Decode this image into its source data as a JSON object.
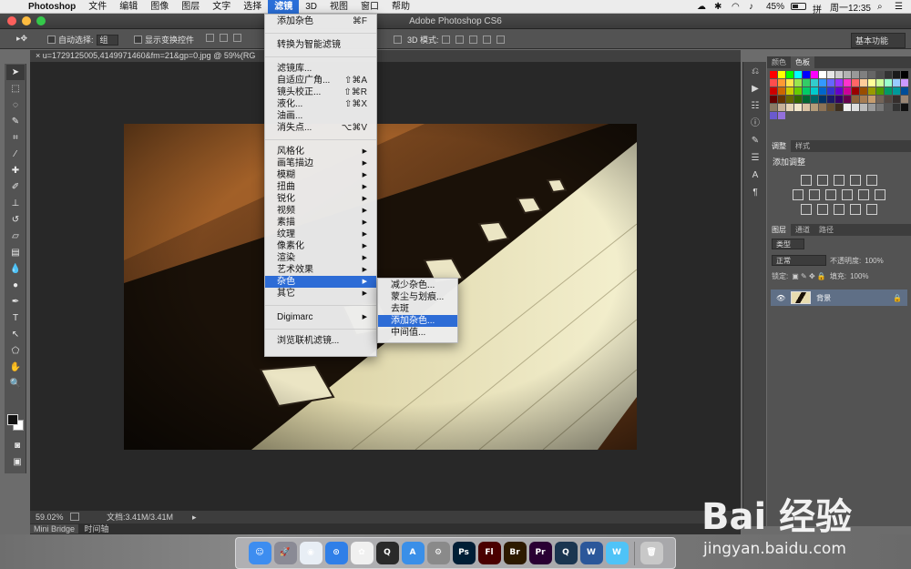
{
  "menubar": {
    "app_name": "Photoshop",
    "items": [
      "文件",
      "编辑",
      "图像",
      "图层",
      "文字",
      "选择",
      "滤镜",
      "3D",
      "视图",
      "窗口",
      "帮助"
    ],
    "active_item": "滤镜",
    "battery": "45%",
    "clock": "周一12:35"
  },
  "window": {
    "title": "Adobe Photoshop CS6"
  },
  "options_bar": {
    "auto_select_label": "自动选择:",
    "auto_select_value": "组",
    "show_transform_label": "显示变换控件",
    "mode_3d_label": "3D 模式:",
    "workspace": "基本功能"
  },
  "document": {
    "tab_title": "u=1729125005,4149971460&fm=21&gp=0.jpg @ 59%(RG",
    "zoom": "59.02%",
    "doc_size": "文档:3.41M/3.41M"
  },
  "bottom_tabs": [
    "Mini Bridge",
    "时间轴"
  ],
  "filter_menu": {
    "items": [
      {
        "label": "添加杂色",
        "shortcut": "⌘F"
      },
      {
        "sep": true
      },
      {
        "label": "转换为智能滤镜"
      },
      {
        "sep": true
      },
      {
        "label": "滤镜库..."
      },
      {
        "label": "自适应广角...",
        "shortcut": "⇧⌘A"
      },
      {
        "label": "镜头校正...",
        "shortcut": "⇧⌘R"
      },
      {
        "label": "液化...",
        "shortcut": "⇧⌘X"
      },
      {
        "label": "油画..."
      },
      {
        "label": "消失点...",
        "shortcut": "⌥⌘V"
      },
      {
        "sep": true
      },
      {
        "label": "风格化",
        "sub": true
      },
      {
        "label": "画笔描边",
        "sub": true
      },
      {
        "label": "模糊",
        "sub": true
      },
      {
        "label": "扭曲",
        "sub": true
      },
      {
        "label": "锐化",
        "sub": true
      },
      {
        "label": "视频",
        "sub": true
      },
      {
        "label": "素描",
        "sub": true
      },
      {
        "label": "纹理",
        "sub": true
      },
      {
        "label": "像素化",
        "sub": true
      },
      {
        "label": "渲染",
        "sub": true
      },
      {
        "label": "艺术效果",
        "sub": true
      },
      {
        "label": "杂色",
        "sub": true,
        "highlight": true
      },
      {
        "label": "其它",
        "sub": true
      },
      {
        "sep": true
      },
      {
        "label": "Digimarc",
        "sub": true
      },
      {
        "sep": true
      },
      {
        "label": "浏览联机滤镜..."
      }
    ]
  },
  "noise_submenu": {
    "items": [
      {
        "label": "减少杂色..."
      },
      {
        "label": "蒙尘与划痕..."
      },
      {
        "label": "去斑"
      },
      {
        "label": "添加杂色...",
        "highlight": true
      },
      {
        "label": "中间值..."
      }
    ]
  },
  "panels": {
    "color_tabs": [
      "颜色",
      "色板"
    ],
    "color_active": "色板",
    "adjust_tabs": [
      "调整",
      "样式"
    ],
    "adjust_active": "调整",
    "adjust_title": "添加调整",
    "layer_tabs": [
      "图层",
      "通道",
      "路径"
    ],
    "layer_active": "图层",
    "kind_filter": "类型",
    "blend_mode": "正常",
    "opacity_label": "不透明度:",
    "opacity_value": "100%",
    "lock_label": "锁定:",
    "fill_label": "填充:",
    "fill_value": "100%",
    "layer_name": "背景"
  },
  "dock": {
    "apps": [
      "Finder",
      "Launchpad",
      "Chrome",
      "Safari",
      "Photos",
      "QQ",
      "App Store",
      "System Preferences",
      "Ps",
      "Fl",
      "Br",
      "Pr",
      "QuickTime",
      "Word",
      "W",
      "Trash"
    ]
  },
  "watermark": {
    "logo": "Bai 经验",
    "url": "jingyan.baidu.com"
  }
}
